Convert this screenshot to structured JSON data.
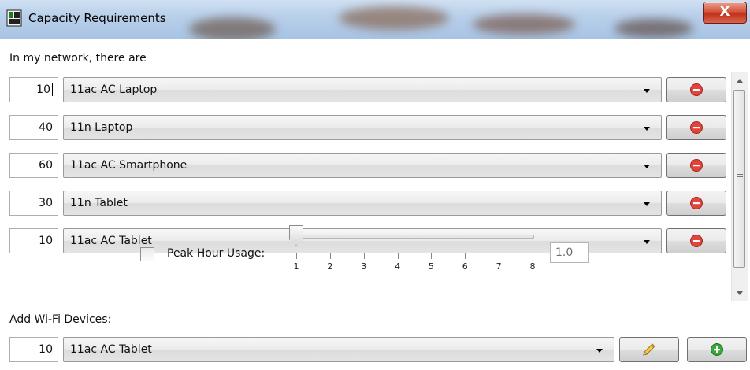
{
  "window": {
    "title": "Capacity Requirements",
    "close_label": "X"
  },
  "network_label": "In my network, there are",
  "devices": [
    {
      "count": "10",
      "type": "11ac AC Laptop"
    },
    {
      "count": "40",
      "type": "11n Laptop"
    },
    {
      "count": "60",
      "type": "11ac AC Smartphone"
    },
    {
      "count": "30",
      "type": "11n Tablet"
    },
    {
      "count": "10",
      "type": "11ac AC Tablet"
    }
  ],
  "peak_hour": {
    "label": "Peak Hour Usage:",
    "checked": false,
    "slider_value": "1.0",
    "slider_position": 1,
    "ticks": [
      "1",
      "2",
      "3",
      "4",
      "5",
      "6",
      "7",
      "8"
    ]
  },
  "add_devices": {
    "label": "Add Wi-Fi Devices:",
    "count": "10",
    "type": "11ac AC Tablet"
  },
  "colors": {
    "remove_icon": "#e2433a",
    "add_icon": "#3aa83a",
    "edit_icon": "#e8b830"
  }
}
